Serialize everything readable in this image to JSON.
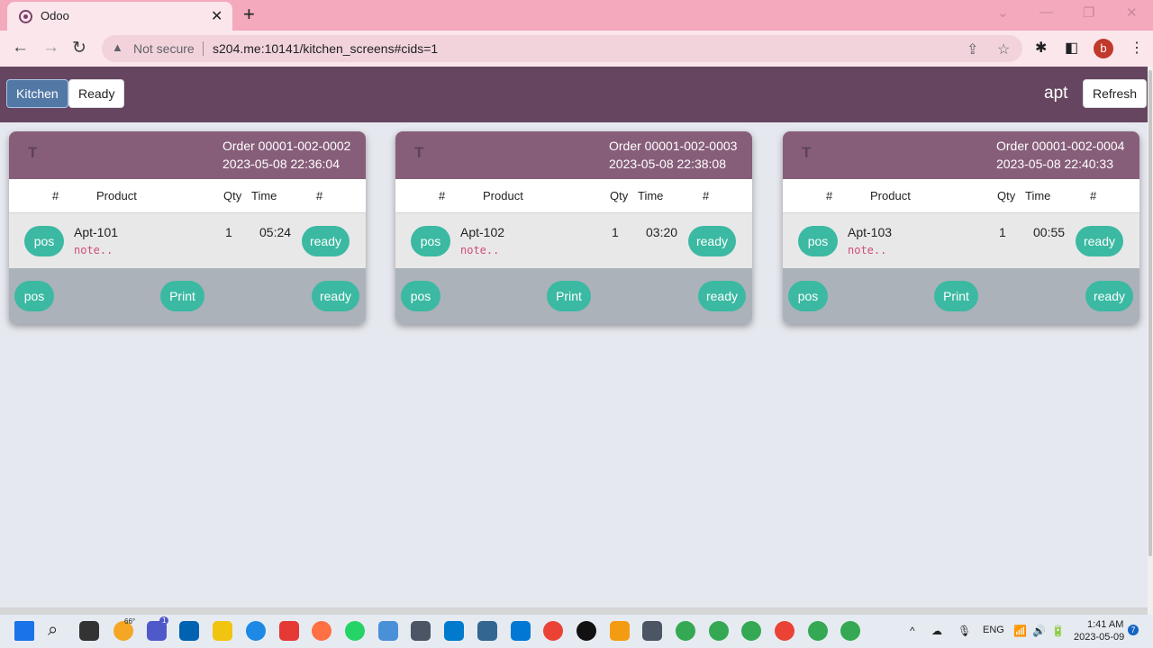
{
  "browser": {
    "tab_title": "Odoo",
    "tab_close": "✕",
    "new_tab": "+",
    "security_label": "Not secure",
    "url": "s204.me:10141/kitchen_screens#cids=1",
    "profile_initial": "b"
  },
  "header": {
    "kitchen_label": "Kitchen",
    "ready_label": "Ready",
    "user_name": "apt",
    "refresh_label": "Refresh"
  },
  "columns": {
    "hash1": "#",
    "product": "Product",
    "qty": "Qty",
    "time": "Time",
    "hash2": "#"
  },
  "orders": [
    {
      "letter": "T",
      "order": "Order 00001-002-0002",
      "date": "2023-05-08 22:36:04",
      "line": {
        "pos": "pos",
        "product": "Apt-101",
        "note": "note..",
        "qty": "1",
        "time": "05:24",
        "ready": "ready"
      },
      "footer": {
        "pos": "pos",
        "print": "Print",
        "ready": "ready"
      }
    },
    {
      "letter": "T",
      "order": "Order 00001-002-0003",
      "date": "2023-05-08 22:38:08",
      "line": {
        "pos": "pos",
        "product": "Apt-102",
        "note": "note..",
        "qty": "1",
        "time": "03:20",
        "ready": "ready"
      },
      "footer": {
        "pos": "pos",
        "print": "Print",
        "ready": "ready"
      }
    },
    {
      "letter": "T",
      "order": "Order 00001-002-0004",
      "date": "2023-05-08 22:40:33",
      "line": {
        "pos": "pos",
        "product": "Apt-103",
        "note": "note..",
        "qty": "1",
        "time": "00:55",
        "ready": "ready"
      },
      "footer": {
        "pos": "pos",
        "print": "Print",
        "ready": "ready"
      }
    }
  ],
  "taskbar": {
    "weather": "66°",
    "teams_badge": "1",
    "language": "ENG",
    "time": "1:41 AM",
    "date": "2023-05-09",
    "notification_count": "7"
  },
  "colors": {
    "header_bg": "#65455f",
    "card_head": "#875e79",
    "pill": "#3bb9a2",
    "kitchen_btn": "#5278a6"
  }
}
